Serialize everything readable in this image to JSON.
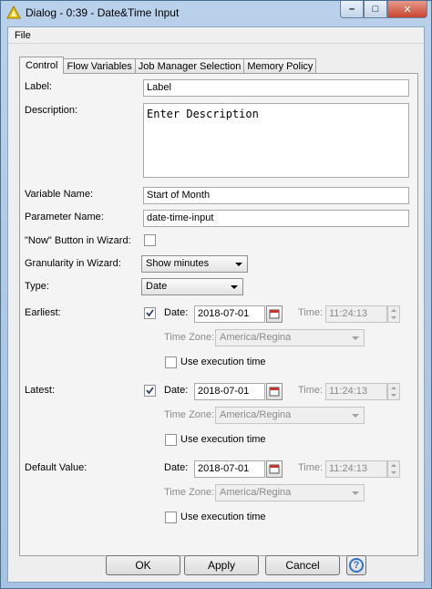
{
  "window": {
    "title": "Dialog - 0:39 - Date&Time Input",
    "minimize_glyph": "–",
    "maximize_glyph": "□",
    "close_glyph": "✕"
  },
  "menu": {
    "file": "File"
  },
  "tabs": [
    {
      "label": "Control",
      "active": true
    },
    {
      "label": "Flow Variables",
      "active": false
    },
    {
      "label": "Job Manager Selection",
      "active": false
    },
    {
      "label": "Memory Policy",
      "active": false
    }
  ],
  "form": {
    "label_caption": "Label:",
    "label_value": "Label",
    "description_caption": "Description:",
    "description_value": "Enter Description",
    "variable_name_caption": "Variable Name:",
    "variable_name_value": "Start of Month",
    "parameter_name_caption": "Parameter Name:",
    "parameter_name_value": "date-time-input",
    "now_button_caption": "\"Now\" Button in Wizard:",
    "now_button_checked": false,
    "granularity_caption": "Granularity in Wizard:",
    "granularity_value": "Show minutes",
    "type_caption": "Type:",
    "type_value": "Date"
  },
  "earliest": {
    "caption": "Earliest:",
    "checked": true,
    "date_caption": "Date:",
    "date_value": "2018-07-01",
    "time_caption": "Time:",
    "time_value": "11:24:13",
    "timezone_caption": "Time Zone:",
    "timezone_value": "America/Regina",
    "exec_time_caption": "Use execution time",
    "exec_time_checked": false
  },
  "latest": {
    "caption": "Latest:",
    "checked": true,
    "date_caption": "Date:",
    "date_value": "2018-07-01",
    "time_caption": "Time:",
    "time_value": "11:24:13",
    "timezone_caption": "Time Zone:",
    "timezone_value": "America/Regina",
    "exec_time_caption": "Use execution time",
    "exec_time_checked": false
  },
  "default_value": {
    "caption": "Default Value:",
    "date_caption": "Date:",
    "date_value": "2018-07-01",
    "time_caption": "Time:",
    "time_value": "11:24:13",
    "timezone_caption": "Time Zone:",
    "timezone_value": "America/Regina",
    "exec_time_caption": "Use execution time",
    "exec_time_checked": false
  },
  "buttons": {
    "ok": "OK",
    "apply": "Apply",
    "cancel": "Cancel",
    "help": "?"
  },
  "colors": {
    "titlebar": "#b9d1ea",
    "panel": "#f4f4f4",
    "help_accent": "#2a72c8",
    "close": "#c7452f"
  }
}
